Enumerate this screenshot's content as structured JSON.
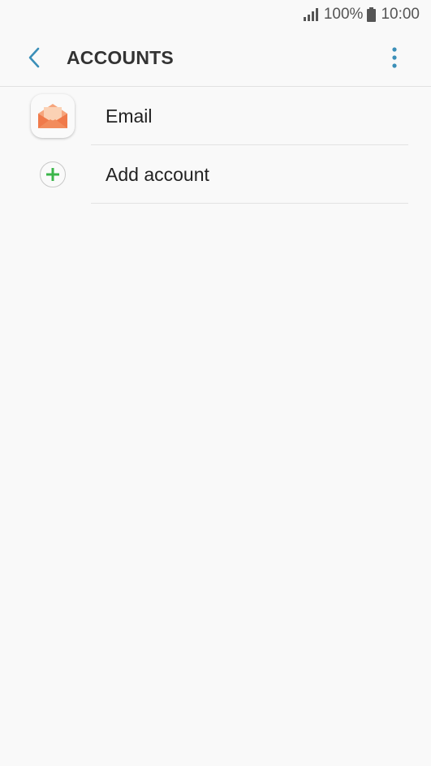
{
  "status_bar": {
    "battery_text": "100%",
    "time": "10:00"
  },
  "app_bar": {
    "title": "ACCOUNTS",
    "back_icon": "chevron-left-icon",
    "more_icon": "more-vertical-icon"
  },
  "accounts": [
    {
      "label": "Email",
      "icon": "email-app-icon"
    },
    {
      "label": "Add account",
      "icon": "plus-icon"
    }
  ],
  "colors": {
    "accent": "#3b8fb8",
    "add_green": "#3bb54a",
    "email_orange": "#f07a4a",
    "email_letter": "#fbd1b4"
  }
}
